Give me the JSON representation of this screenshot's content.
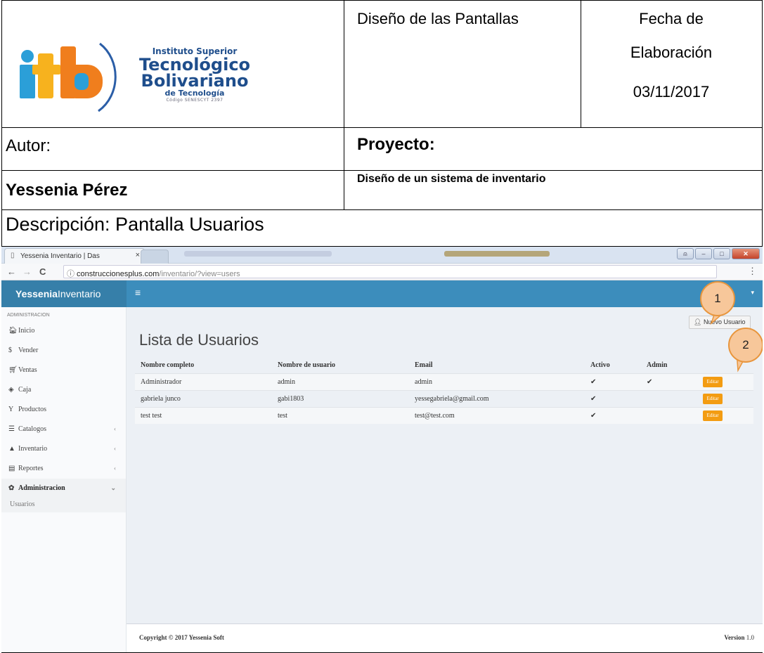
{
  "header": {
    "logo": {
      "line1": "Instituto Superior",
      "line2": "Tecnológico",
      "line3": "Bolivariano",
      "line4": "de Tecnología",
      "line5": "Código SENESCYT 2397",
      "mark": "itb"
    },
    "design_title": "Diseño de las Pantallas",
    "date_label_1": "Fecha de",
    "date_label_2": "Elaboración",
    "date_value": "03/11/2017",
    "author_label": "Autor:",
    "author_name": "Yessenia Pérez",
    "project_label": "Proyecto:",
    "project_name": "Diseño de un sistema de inventario",
    "description": "Descripción: Pantalla Usuarios"
  },
  "browser": {
    "tab_title": "Yessenia Inventario | Das",
    "tab_close": "×",
    "url_host": "construccionesplus.com",
    "url_path": "/inventario/?view=users",
    "back_icon": "←",
    "forward_icon": "→",
    "reload_icon": "C",
    "info_icon": "ⓘ",
    "menu_icon": "⋮"
  },
  "app": {
    "brand_bold": "Yessenia",
    "brand_rest": "Inventario",
    "hamburger": "≡",
    "user_caret": "▾",
    "sidebar": {
      "heading": "ADMINISTRACION",
      "items": [
        {
          "icon": "home-icon",
          "glyph": "🏠︎",
          "label": "Inicio",
          "arrow": ""
        },
        {
          "icon": "dollar-icon",
          "glyph": "$",
          "label": "Vender",
          "arrow": ""
        },
        {
          "icon": "cart-icon",
          "glyph": "🛒︎",
          "label": "Ventas",
          "arrow": ""
        },
        {
          "icon": "cube-icon",
          "glyph": "◈",
          "label": "Caja",
          "arrow": ""
        },
        {
          "icon": "glass-icon",
          "glyph": "Y",
          "label": "Productos",
          "arrow": ""
        },
        {
          "icon": "database-icon",
          "glyph": "☰",
          "label": "Catalogos",
          "arrow": "‹"
        },
        {
          "icon": "area-chart-icon",
          "glyph": "▲",
          "label": "Inventario",
          "arrow": "‹"
        },
        {
          "icon": "file-icon",
          "glyph": "▤",
          "label": "Reportes",
          "arrow": "‹"
        },
        {
          "icon": "cog-icon",
          "glyph": "✿",
          "label": "Administracion",
          "arrow": "⌄"
        }
      ],
      "subitem": "Usuarios"
    },
    "page_title": "Lista de Usuarios",
    "new_user_button": "Nuevo Usuario",
    "table": {
      "headers": [
        "Nombre completo",
        "Nombre de usuario",
        "Email",
        "Activo",
        "Admin",
        ""
      ],
      "rows": [
        {
          "name": "Administrador",
          "username": "admin",
          "email": "admin",
          "activo": "✔",
          "admin": "✔",
          "action": "Editar"
        },
        {
          "name": "gabriela junco",
          "username": "gabi1803",
          "email": "yessegabriela@gmail.com",
          "activo": "✔",
          "admin": "",
          "action": "Editar"
        },
        {
          "name": "test test",
          "username": "test",
          "email": "test@test.com",
          "activo": "✔",
          "admin": "",
          "action": "Editar"
        }
      ]
    },
    "footer_left": "Copyright © 2017 Yessenia Soft",
    "footer_version_label": "Version",
    "footer_version_value": "1.0"
  },
  "callouts": [
    "1",
    "2"
  ],
  "colors": {
    "topbar": "#3c8dbc",
    "brand": "#367fa9",
    "edit_button": "#f39c12",
    "callout_fill": "#f7c79a"
  }
}
